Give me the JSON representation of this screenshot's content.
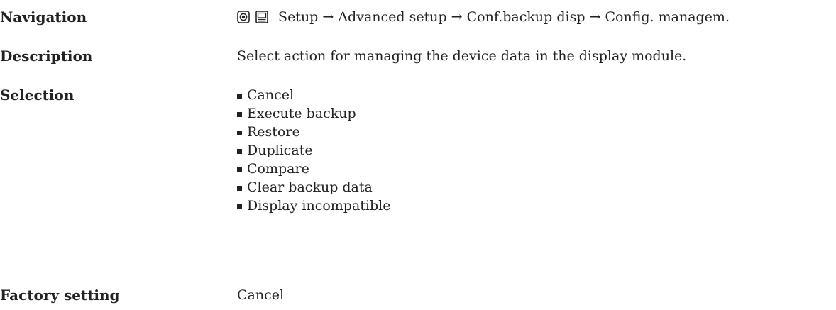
{
  "navigation": {
    "label": "Navigation",
    "path": "Setup → Advanced setup → Conf.backup disp → Config. managem.",
    "icons": [
      "operating-menu-icon",
      "display-menu-icon"
    ]
  },
  "description": {
    "label": "Description",
    "text": "Select action for managing the device data in the display module."
  },
  "selection": {
    "label": "Selection",
    "options": [
      "Cancel",
      "Execute backup",
      "Restore",
      "Duplicate",
      "Compare",
      "Clear backup data",
      "Display incompatible"
    ]
  },
  "factory_setting": {
    "label": "Factory setting",
    "value": "Cancel"
  }
}
